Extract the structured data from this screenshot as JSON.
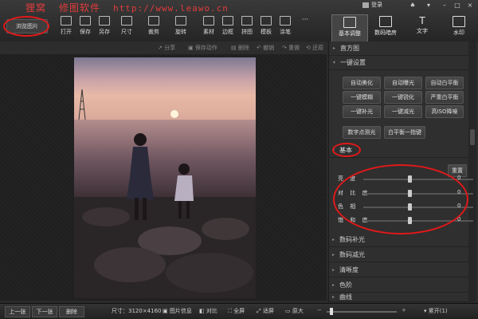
{
  "brand": {
    "name": "狸窝",
    "product": "修图软件",
    "url": "http://www.leawo.cn"
  },
  "toolbar": {
    "browse": "浏览图片",
    "items": [
      {
        "label": "打开",
        "icon": "open-icon"
      },
      {
        "label": "保存",
        "icon": "save-icon"
      },
      {
        "label": "另存",
        "icon": "save-as-icon"
      },
      {
        "label": "尺寸",
        "icon": "resize-icon"
      },
      {
        "label": "裁剪",
        "icon": "crop-icon"
      },
      {
        "label": "旋转",
        "icon": "rotate-icon"
      },
      {
        "label": "素材",
        "icon": "material-icon"
      },
      {
        "label": "边框",
        "icon": "border-icon"
      },
      {
        "label": "拼图",
        "icon": "collage-icon"
      },
      {
        "label": "模板",
        "icon": "template-icon"
      },
      {
        "label": "涂笔",
        "icon": "brush-icon"
      },
      {
        "label": "···",
        "icon": "more-icon"
      }
    ]
  },
  "login": "登录",
  "right_tabs": [
    {
      "label": "基本调整",
      "icon": "adjust-icon"
    },
    {
      "label": "数码暗房",
      "icon": "camera-icon"
    },
    {
      "label": "文字",
      "icon": "text-icon"
    },
    {
      "label": "水印",
      "icon": "watermark-icon"
    }
  ],
  "subbar": {
    "share": "分享",
    "save_action": "保存动作",
    "delete": "删除",
    "undo": "撤销",
    "redo": "重做",
    "restore": "还原"
  },
  "panel": {
    "histogram": "直方图",
    "oneclick": "一键设置",
    "oneclick_buttons": [
      "自动美化",
      "自动曝光",
      "自动白平衡",
      "一键模糊",
      "一键锐化",
      "严重白平衡",
      "一键补光",
      "一键减光",
      "高ISO降噪"
    ],
    "extra_buttons": [
      "数字点测光",
      "白平衡一指键"
    ],
    "basic": "基本",
    "reset": "重置",
    "sliders": [
      {
        "label": "亮    度",
        "value": "0"
      },
      {
        "label": "对 比 度",
        "value": "0"
      },
      {
        "label": "色    相",
        "value": "0"
      },
      {
        "label": "饱 和 度",
        "value": "0"
      }
    ],
    "sections": [
      "数码补光",
      "数码减光",
      "清晰度",
      "色阶",
      "曲线"
    ]
  },
  "status": {
    "prev": "上一张",
    "next": "下一张",
    "delete": "删除",
    "size": "尺寸：3120×4160",
    "info": "图片信息",
    "compare": "对比",
    "fullscreen": "全屏",
    "fit": "适屏",
    "original": "原大",
    "batch": "累开(1)"
  },
  "colors": {
    "annotation": "#e0191a",
    "brand": "#e23b3b"
  }
}
